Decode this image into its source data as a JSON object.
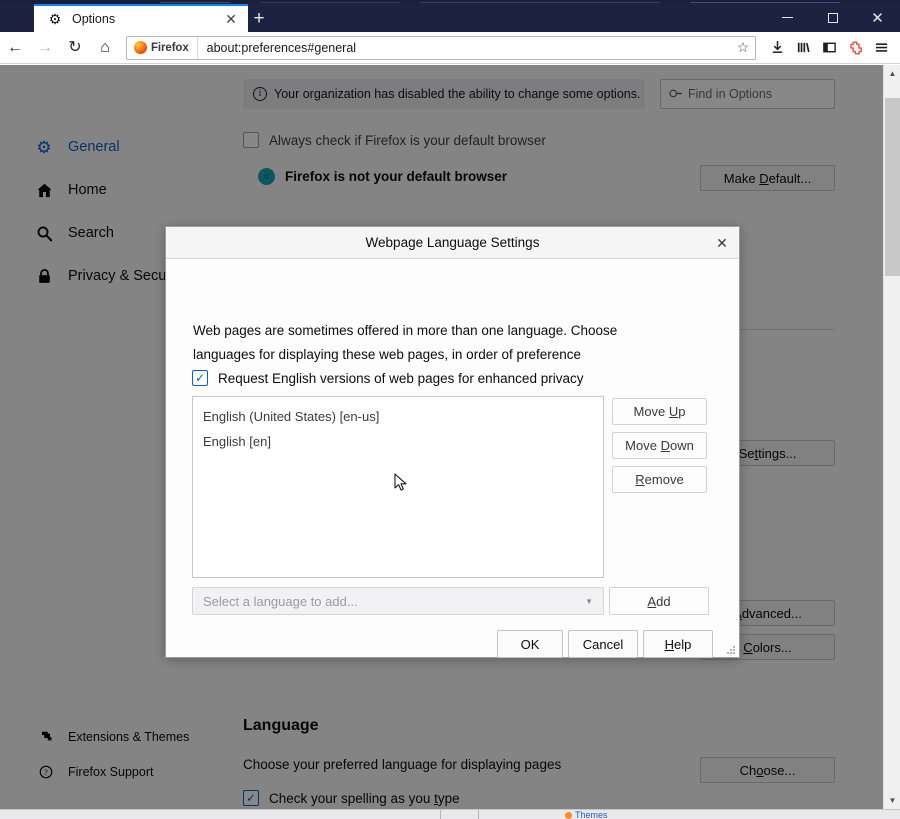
{
  "window": {
    "tab": {
      "title": "Options",
      "favicon_icon": "gear-icon",
      "close_icon": "close-icon"
    },
    "new_tab_icon": "plus-icon",
    "controls": {
      "minimize_icon": "minimize-icon",
      "maximize_icon": "maximize-icon",
      "close_icon": "close-icon"
    }
  },
  "toolbar": {
    "back_icon": "back-arrow-icon",
    "forward_icon": "forward-arrow-icon",
    "reload_icon": "reload-icon",
    "home_icon": "home-icon",
    "identity_label": "Firefox",
    "url": "about:preferences#general",
    "bookmark_icon": "star-icon",
    "downloads_icon": "downloads-icon",
    "library_icon": "library-icon",
    "sidebar_icon": "sidebar-icon",
    "extension_icon": "extension-puzzle-icon",
    "menu_icon": "hamburger-menu-icon"
  },
  "sidebar": {
    "items": [
      {
        "label": "General",
        "icon": "gear-icon",
        "selected": true
      },
      {
        "label": "Home",
        "icon": "home-icon",
        "selected": false
      },
      {
        "label": "Search",
        "icon": "magnifier-icon",
        "selected": false
      },
      {
        "label": "Privacy & Security",
        "icon": "lock-icon",
        "selected": false
      }
    ],
    "footer_items": [
      {
        "label": "Extensions & Themes",
        "icon": "puzzle-icon"
      },
      {
        "label": "Firefox Support",
        "icon": "question-circle-icon"
      }
    ]
  },
  "page": {
    "org_notice": "Your organization has disabled the ability to change some options.",
    "org_notice_icon": "info-circle-icon",
    "find_placeholder": "Find in Options",
    "find_icon": "search-icon",
    "always_check_label": "Always check if Firefox is your default browser",
    "not_default_label": "Firefox is not your default browser",
    "make_default_button": {
      "pre": "Make ",
      "key": "D",
      "post": "efault..."
    },
    "settings_button": {
      "pre": "Se",
      "key": "t",
      "post": "tings..."
    },
    "advanced_button": {
      "pre": "",
      "key": "A",
      "post": "dvanced..."
    },
    "colors_button": {
      "pre": "",
      "key": "C",
      "post": "olors..."
    },
    "language_section_title": "Language",
    "language_desc": "Choose your preferred language for displaying pages",
    "choose_button": {
      "pre": "Ch",
      "key": "o",
      "post": "ose..."
    },
    "spellcheck_label": {
      "pre": "Check your spelling as you ",
      "key": "t",
      "post": "ype"
    }
  },
  "dialog": {
    "title": "Webpage Language Settings",
    "close_icon": "close-icon",
    "description": "Web pages are sometimes offered in more than one language. Choose languages for displaying these web pages, in order of preference",
    "privacy_checkbox_label": "Request English versions of web pages for enhanced privacy",
    "languages": [
      "English (United States) [en-us]",
      "English [en]"
    ],
    "side_buttons": [
      {
        "pre": "Move ",
        "key": "U",
        "post": "p"
      },
      {
        "pre": "Move ",
        "key": "D",
        "post": "own"
      },
      {
        "pre": "",
        "key": "R",
        "post": "emove"
      }
    ],
    "select_placeholder": "Select a language to add...",
    "select_caret_icon": "chevron-down-icon",
    "add_button": {
      "pre": "",
      "key": "A",
      "post": "dd"
    },
    "ok_button": {
      "pre": "OK",
      "key": "",
      "post": ""
    },
    "cancel_button": {
      "pre": "Cancel",
      "key": "",
      "post": ""
    },
    "help_button": {
      "pre": "",
      "key": "H",
      "post": "elp"
    },
    "resize_grip_icon": "resize-grip-icon"
  },
  "taskbar": {
    "items": [
      {
        "label": "Themes",
        "icon": "firefox-icon"
      }
    ]
  },
  "colors": {
    "accent": "#0a84ff",
    "titlebar": "#1c2340",
    "selected_text": "#0a60c8",
    "overlay": "rgba(0,0,0,0.47)"
  }
}
